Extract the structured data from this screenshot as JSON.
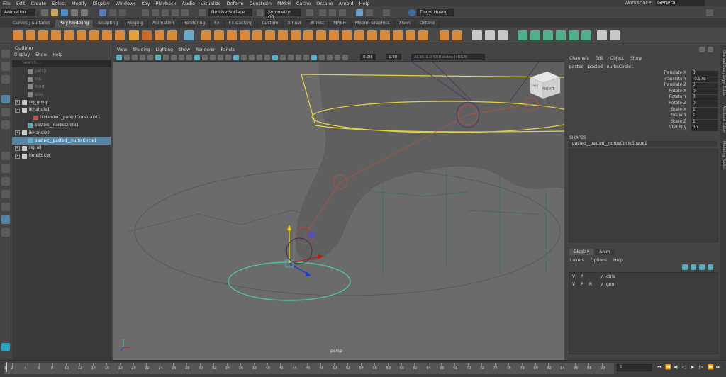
{
  "menubar": [
    "File",
    "Edit",
    "Create",
    "Select",
    "Modify",
    "Display",
    "Windows",
    "Key",
    "Playback",
    "Audio",
    "Visualize",
    "Deform",
    "Constrain",
    "MASH",
    "Cache",
    "Octane",
    "Arnold",
    "Help"
  ],
  "workspace": {
    "label": "Workspace:",
    "value": "General"
  },
  "status": {
    "mode": "Animation",
    "live_surface": "No Live Surface",
    "symmetry": "Symmetry: Off",
    "user": "Tingyi Huang"
  },
  "shelf_tabs": [
    "Curves / Surfaces",
    "Poly Modeling",
    "Sculpting",
    "Rigging",
    "Animation",
    "Rendering",
    "FX",
    "FX Caching",
    "Custom",
    "Arnold",
    "Bifrost",
    "MASH",
    "Motion Graphics",
    "XGen",
    "Octane"
  ],
  "shelf_active": "Poly Modeling",
  "outliner": {
    "title": "Outliner",
    "menu": [
      "Display",
      "Show",
      "Help"
    ],
    "search_placeholder": "Search...",
    "rows": [
      {
        "label": "persp",
        "indent": 1,
        "dim": true,
        "pm": ""
      },
      {
        "label": "top",
        "indent": 1,
        "dim": true,
        "pm": ""
      },
      {
        "label": "front",
        "indent": 1,
        "dim": true,
        "pm": ""
      },
      {
        "label": "side",
        "indent": 1,
        "dim": true,
        "pm": ""
      },
      {
        "label": "rig_group",
        "indent": 0,
        "dim": false,
        "pm": "+"
      },
      {
        "label": "ikHandle1",
        "indent": 0,
        "dim": false,
        "pm": "−"
      },
      {
        "label": "ikHandle1_parentConstraint1",
        "indent": 2,
        "dim": false,
        "pm": ""
      },
      {
        "label": "pasted__nurbsCircle1",
        "indent": 1,
        "dim": false,
        "pm": ""
      },
      {
        "label": "ikHandle2",
        "indent": 0,
        "dim": false,
        "pm": "+"
      },
      {
        "label": "pasted__pasted__nurbsCircle1",
        "indent": 1,
        "dim": false,
        "pm": "",
        "sel": true
      },
      {
        "label": "rig_all",
        "indent": 0,
        "dim": false,
        "pm": "+"
      },
      {
        "label": "timeEditor",
        "indent": 0,
        "dim": false,
        "pm": "+"
      }
    ]
  },
  "viewport": {
    "menu": [
      "View",
      "Shading",
      "Lighting",
      "Show",
      "Renderer",
      "Panels"
    ],
    "exposure": "0.00",
    "gamma": "1.00",
    "colorspace": "ACES 1.0 SDR-video (sRGB)",
    "camera_label": "persp",
    "cube_front": "FRONT",
    "cube_left": "LEFT"
  },
  "channel_box": {
    "menu": [
      "Channels",
      "Edit",
      "Object",
      "Show"
    ],
    "object": "pasted__pasted__nurbsCircle1",
    "attributes": [
      {
        "name": "Translate X",
        "value": "0"
      },
      {
        "name": "Translate Y",
        "value": "-0.578"
      },
      {
        "name": "Translate Z",
        "value": "0"
      },
      {
        "name": "Rotate X",
        "value": "0"
      },
      {
        "name": "Rotate Y",
        "value": "0"
      },
      {
        "name": "Rotate Z",
        "value": "0"
      },
      {
        "name": "Scale X",
        "value": "1"
      },
      {
        "name": "Scale Y",
        "value": "1"
      },
      {
        "name": "Scale Z",
        "value": "1"
      },
      {
        "name": "Visibility",
        "value": "on"
      }
    ],
    "shapes_label": "SHAPES",
    "shape": "pasted__pasted__nurbsCircleShape1"
  },
  "layer_editor": {
    "tabs": [
      "Display",
      "Anim"
    ],
    "menu": [
      "Layers",
      "Options",
      "Help"
    ],
    "layers": [
      {
        "v": "V",
        "p": "P",
        "r": "",
        "name": "ctrls"
      },
      {
        "v": "V",
        "p": "P",
        "r": "R",
        "name": "geo"
      }
    ]
  },
  "side_tabs": [
    "Channel Box / Layer Editor",
    "Attribute Editor",
    "Modeling Toolkit"
  ],
  "timeline": {
    "ticks": [
      "1",
      "2",
      "4",
      "6",
      "8",
      "10",
      "12",
      "14",
      "16",
      "18",
      "20",
      "22",
      "24",
      "26",
      "28",
      "30",
      "32",
      "34",
      "36",
      "38",
      "40",
      "42",
      "44",
      "46",
      "48",
      "50",
      "52",
      "54",
      "56",
      "58",
      "60",
      "62",
      "64",
      "66",
      "68",
      "70",
      "72",
      "74",
      "76",
      "78",
      "80",
      "82",
      "84",
      "86",
      "88",
      "90"
    ],
    "current_frame": "1"
  }
}
